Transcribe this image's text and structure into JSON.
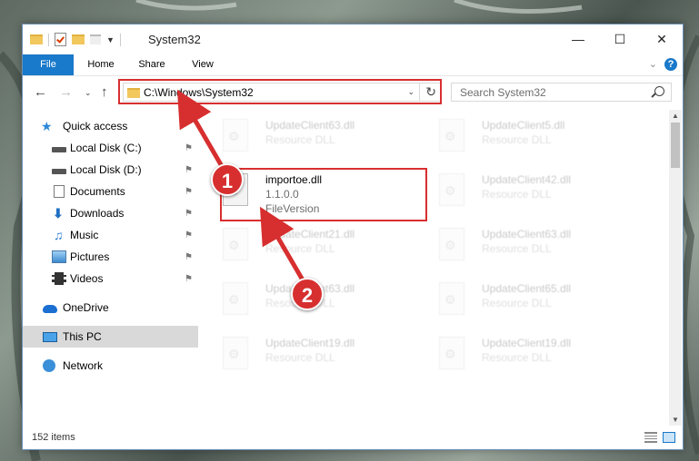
{
  "window": {
    "title": "System32",
    "controls": {
      "minimize": "—",
      "maximize": "☐",
      "close": "✕"
    }
  },
  "ribbon": {
    "tabs": [
      "File",
      "Home",
      "Share",
      "View"
    ],
    "collapse_glyph": "⌄",
    "help_glyph": "?"
  },
  "nav": {
    "back_glyph": "←",
    "forward_glyph": "→",
    "recent_glyph": "⌄",
    "up_glyph": "↑",
    "address": "C:\\Windows\\System32",
    "address_dropdown_glyph": "⌄",
    "refresh_glyph": "↻",
    "search_placeholder": "Search System32"
  },
  "sidebar": {
    "pin_glyph": "⚑",
    "items": [
      {
        "label": "Quick access",
        "icon": "star-icon"
      },
      {
        "label": "Local Disk (C:)",
        "icon": "drive-icon",
        "pinned": true
      },
      {
        "label": "Local Disk (D:)",
        "icon": "drive-icon",
        "pinned": true
      },
      {
        "label": "Documents",
        "icon": "documents-icon",
        "pinned": true
      },
      {
        "label": "Downloads",
        "icon": "downloads-icon",
        "pinned": true
      },
      {
        "label": "Music",
        "icon": "music-icon",
        "pinned": true
      },
      {
        "label": "Pictures",
        "icon": "pictures-icon",
        "pinned": true
      },
      {
        "label": "Videos",
        "icon": "videos-icon",
        "pinned": true
      },
      {
        "label": "OneDrive",
        "icon": "onedrive-icon"
      },
      {
        "label": "This PC",
        "icon": "this-pc-icon",
        "selected": true
      },
      {
        "label": "Network",
        "icon": "network-icon"
      }
    ]
  },
  "files": {
    "highlighted": {
      "name": "importoe.dll",
      "version": "1.1.0.0",
      "description": "FileVersion"
    },
    "left_column": [
      {
        "name": "UpdateClient63.dll",
        "type": "Resource DLL"
      },
      {
        "name": "UpdateClient21.dll",
        "type": "Resource DLL"
      },
      {
        "name": "UpdateClient63.dll",
        "type": "Resource DLL"
      },
      {
        "name": "UpdateClient19.dll",
        "type": "Resource DLL"
      }
    ],
    "right_column": [
      {
        "name": "UpdateClient5.dll",
        "type": "Resource DLL"
      },
      {
        "name": "UpdateClient42.dll",
        "type": "Resource DLL"
      },
      {
        "name": "UpdateClient63.dll",
        "type": "Resource DLL"
      },
      {
        "name": "UpdateClient65.dll",
        "type": "Resource DLL"
      },
      {
        "name": "UpdateClient19.dll",
        "type": "Resource DLL"
      }
    ]
  },
  "status": {
    "item_count": "152 items"
  },
  "annotations": {
    "step1": "1",
    "step2": "2",
    "accent": "#d72f2f"
  }
}
